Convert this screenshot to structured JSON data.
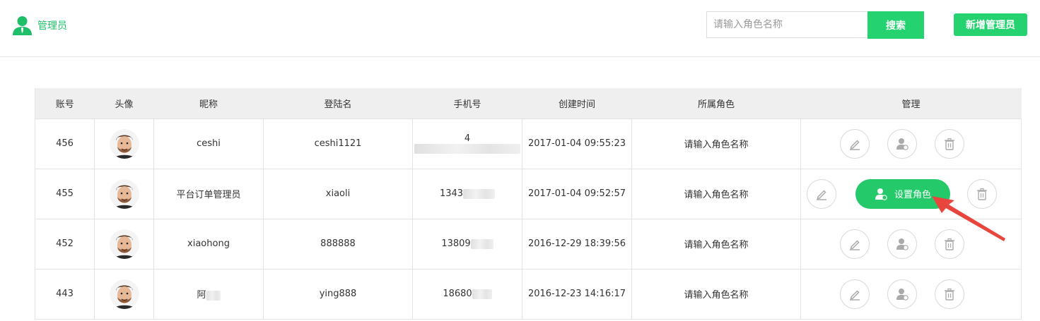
{
  "header": {
    "title": "管理员",
    "search_placeholder": "请输入角色名称",
    "search_button": "搜索",
    "add_button": "新增管理员"
  },
  "table": {
    "columns": [
      "账号",
      "头像",
      "昵称",
      "登陆名",
      "手机号",
      "创建时间",
      "所属角色",
      "管理"
    ],
    "rows": [
      {
        "id": "456",
        "nickname": "ceshi",
        "login": "ceshi1121",
        "phone": "4",
        "created": "2017-01-04 09:55:23",
        "role": "请输入角色名称"
      },
      {
        "id": "455",
        "nickname": "平台订单管理员",
        "login": "xiaoli",
        "phone": "1343",
        "created": "2017-01-04 09:52:57",
        "role": "请输入角色名称"
      },
      {
        "id": "452",
        "nickname": "xiaohong",
        "login": "888888",
        "phone": "13809",
        "created": "2016-12-29 18:39:56",
        "role": "请输入角色名称"
      },
      {
        "id": "443",
        "nickname": "阿",
        "login": "ying888",
        "phone": "18680",
        "created": "2016-12-23 14:16:17",
        "role": "请输入角色名称"
      }
    ]
  },
  "set_role_button": "设置角色",
  "colors": {
    "accent": "#24d36f",
    "brand_text": "#1fbf6a",
    "arrow": "#e8453c"
  },
  "icons": [
    "user-icon",
    "edit-icon",
    "assign-role-icon",
    "trash-icon"
  ]
}
